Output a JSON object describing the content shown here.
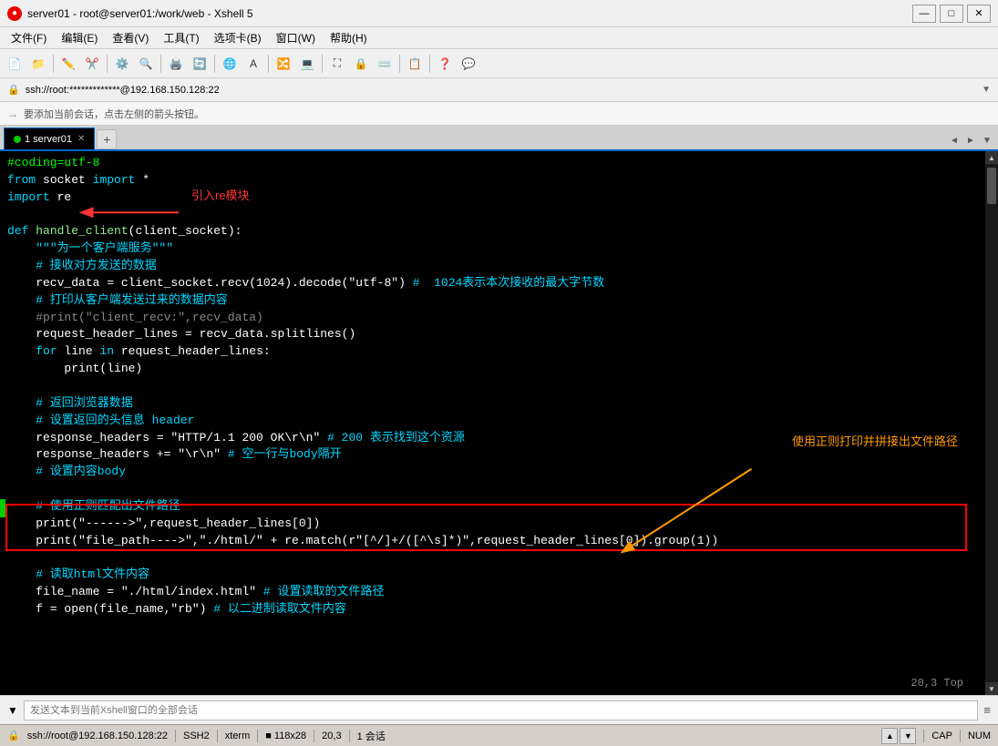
{
  "window": {
    "title": "server01 - root@server01:/work/web - Xshell 5",
    "icon": "●"
  },
  "titlebar": {
    "minimize": "—",
    "maximize": "□",
    "close": "✕"
  },
  "menubar": {
    "items": [
      "文件(F)",
      "编辑(E)",
      "查看(V)",
      "工具(T)",
      "选项卡(B)",
      "窗口(W)",
      "帮助(H)"
    ]
  },
  "addressbar": {
    "icon": "🔒",
    "text": "ssh://root:*************@192.168.150.128:22",
    "dropdown": "▼"
  },
  "infobar": {
    "icon": "→",
    "text": "要添加当前会话，点击左侧的箭头按钮。"
  },
  "tabs": {
    "items": [
      {
        "label": "1 server01",
        "active": true
      }
    ],
    "add": "+",
    "nav_left": "◄",
    "nav_right": "►",
    "nav_menu": "▼"
  },
  "code": {
    "lines": [
      {
        "text": "#coding=utf-8",
        "color": "green"
      },
      {
        "text": "from socket import *",
        "color": "white"
      },
      {
        "text": "import re",
        "color": "white",
        "arrow": true
      },
      {
        "text": "",
        "color": "white"
      },
      {
        "text": "def handle_client(client_socket):",
        "color": "white"
      },
      {
        "text": "    \"\"\"为一个客户端服务\"\"\"",
        "color": "cyan"
      },
      {
        "text": "    # 接收对方发送的数据",
        "color": "cyan"
      },
      {
        "text": "    recv_data = client_socket.recv(1024).decode(\"utf-8\") #  1024表示本次接收的最大字节数",
        "color": "white"
      },
      {
        "text": "    # 打印从客户端发送过来的数据内容",
        "color": "cyan"
      },
      {
        "text": "    #print(\"client_recv:\",recv_data)",
        "color": "comment"
      },
      {
        "text": "    request_header_lines = recv_data.splitlines()",
        "color": "white"
      },
      {
        "text": "    for line in request_header_lines:",
        "color": "white"
      },
      {
        "text": "        print(line)",
        "color": "white"
      },
      {
        "text": "",
        "color": "white"
      },
      {
        "text": "    # 返回浏览器数据",
        "color": "cyan"
      },
      {
        "text": "    # 设置返回的头信息 header",
        "color": "cyan"
      },
      {
        "text": "    response_headers = \"HTTP/1.1 200 OK\\r\\n\" # 200 表示找到这个资源",
        "color": "white"
      },
      {
        "text": "    response_headers += \"\\r\\n\" # 空一行与body隔开",
        "color": "white"
      },
      {
        "text": "    # 设置内容body",
        "color": "cyan"
      },
      {
        "text": "",
        "color": "white"
      },
      {
        "text": "    # 使用正则匹配出文件路径",
        "color": "cyan",
        "highlight_start": true
      },
      {
        "text": "    print(\"------>\",request_header_lines[0])",
        "color": "white"
      },
      {
        "text": "    print(\"file_path---->\",\"./html/\" + re.match(r\"[^/]+/([^\\s]*)\",request_header_lines[0]).group(1))",
        "color": "white",
        "highlight_end": true
      },
      {
        "text": "",
        "color": "white"
      },
      {
        "text": "    # 读取html文件内容",
        "color": "cyan"
      },
      {
        "text": "    file_name = \"./html/index.html\" # 设置读取的文件路径",
        "color": "white"
      },
      {
        "text": "    f = open(file_name,\"rb\") # 以二进制读取文件内容",
        "color": "white"
      }
    ],
    "annotation_import": "引入re模块",
    "annotation_regex": "使用正则打印并拼接出文件路径",
    "pos_info": "20,3                   Top"
  },
  "bottom_input": {
    "placeholder": "发送文本到当前Xshell窗口的全部会话",
    "menu_icon": "≡"
  },
  "statusbar": {
    "lock_icon": "🔒",
    "ssh": "SSH2",
    "term": "xterm",
    "size": "118x28",
    "pos": "20,3",
    "sessions": "1 会话",
    "cap": "CAP",
    "num": "NUM",
    "up_arrow": "▲",
    "down_arrow": "▼"
  }
}
